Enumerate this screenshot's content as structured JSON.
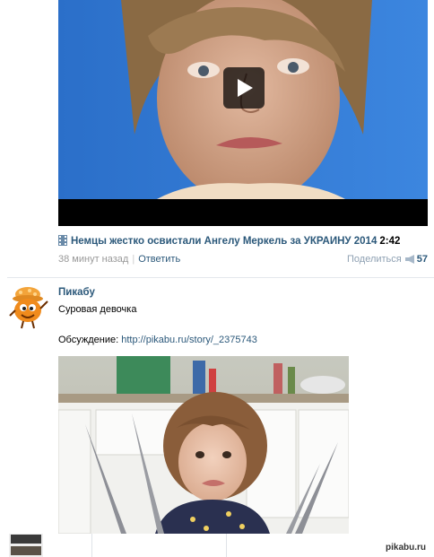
{
  "video_post": {
    "title": "Немцы жестко освистали Ангелу Меркель за УКРАИНУ 2014",
    "duration": "2:42",
    "time_ago": "38 минут назад",
    "reply_label": "Ответить",
    "share_label": "Поделиться",
    "share_count": "57"
  },
  "pikabu_post": {
    "author": "Пикабу",
    "text": "Суровая девочка",
    "discussion_label": "Обсуждение:",
    "discussion_link": "http://pikabu.ru/story/_2375743"
  },
  "watermark": "pikabu.ru",
  "colors": {
    "link": "#2b587a",
    "muted": "#999999",
    "share": "#8fa1b3",
    "divider": "#e4e8ed"
  }
}
